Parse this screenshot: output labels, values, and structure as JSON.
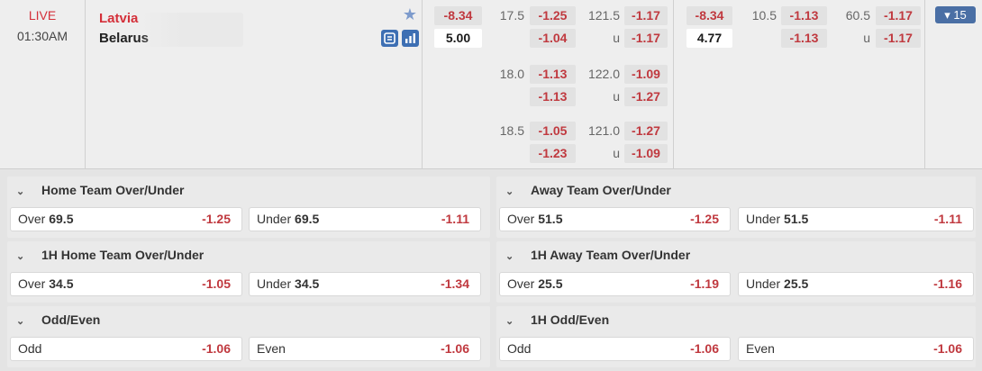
{
  "match": {
    "status": "LIVE",
    "time": "01:30AM",
    "home_team": "Latvia",
    "away_team": "Belarus",
    "more_count": "▾ 15"
  },
  "fulltime": {
    "handicap_home": "-8.34",
    "handicap_away": "5.00",
    "rows": [
      {
        "hdp_line": "17.5",
        "hdp_a": "-1.25",
        "hdp_b": "-1.04",
        "ou_line": "121.5",
        "ou_a": "-1.17",
        "ou_u": "u",
        "ou_b": "-1.17"
      },
      {
        "hdp_line": "18.0",
        "hdp_a": "-1.13",
        "hdp_b": "-1.13",
        "ou_line": "122.0",
        "ou_a": "-1.09",
        "ou_u": "u",
        "ou_b": "-1.27"
      },
      {
        "hdp_line": "18.5",
        "hdp_a": "-1.05",
        "hdp_b": "-1.23",
        "ou_line": "121.0",
        "ou_a": "-1.27",
        "ou_u": "u",
        "ou_b": "-1.09"
      }
    ]
  },
  "firsthalf": {
    "handicap_home": "-8.34",
    "handicap_away": "4.77",
    "hdp_line": "10.5",
    "hdp_a": "-1.13",
    "hdp_b": "-1.13",
    "ou_line": "60.5",
    "ou_a": "-1.17",
    "ou_u": "u",
    "ou_b": "-1.17"
  },
  "markets": [
    {
      "title": "Home Team Over/Under",
      "left": {
        "name": "Over",
        "line": "69.5",
        "odds": "-1.25"
      },
      "right": {
        "name": "Under",
        "line": "69.5",
        "odds": "-1.11"
      }
    },
    {
      "title": "Away Team Over/Under",
      "left": {
        "name": "Over",
        "line": "51.5",
        "odds": "-1.25"
      },
      "right": {
        "name": "Under",
        "line": "51.5",
        "odds": "-1.11"
      }
    },
    {
      "title": "1H Home Team Over/Under",
      "left": {
        "name": "Over",
        "line": "34.5",
        "odds": "-1.05"
      },
      "right": {
        "name": "Under",
        "line": "34.5",
        "odds": "-1.34"
      }
    },
    {
      "title": "1H Away Team Over/Under",
      "left": {
        "name": "Over",
        "line": "25.5",
        "odds": "-1.19"
      },
      "right": {
        "name": "Under",
        "line": "25.5",
        "odds": "-1.16"
      }
    },
    {
      "title": "Odd/Even",
      "left": {
        "name": "Odd",
        "line": "",
        "odds": "-1.06"
      },
      "right": {
        "name": "Even",
        "line": "",
        "odds": "-1.06"
      }
    },
    {
      "title": "1H Odd/Even",
      "left": {
        "name": "Odd",
        "line": "",
        "odds": "-1.06"
      },
      "right": {
        "name": "Even",
        "line": "",
        "odds": "-1.06"
      }
    }
  ],
  "icons": {
    "favorite": "star-icon",
    "stream": "live-stream-icon",
    "stats": "statistics-icon",
    "collapse": "chevron-down-icon"
  },
  "colors": {
    "negative_odds": "#c0393f",
    "live": "#d4303a",
    "accent": "#4a6fa5"
  }
}
